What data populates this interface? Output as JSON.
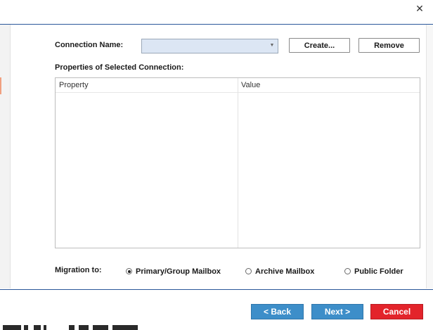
{
  "window": {
    "close_glyph": "✕"
  },
  "connection": {
    "label": "Connection Name:",
    "value": "",
    "create_button": "Create...",
    "remove_button": "Remove"
  },
  "properties": {
    "label": "Properties of Selected Connection:",
    "columns": [
      "Property",
      "Value"
    ],
    "rows": []
  },
  "migration": {
    "label": "Migration to:",
    "options": [
      {
        "label": "Primary/Group Mailbox",
        "selected": true
      },
      {
        "label": "Archive Mailbox",
        "selected": false
      },
      {
        "label": "Public Folder",
        "selected": false
      }
    ]
  },
  "footer": {
    "back_button": "< Back",
    "next_button": "Next >",
    "cancel_button": "Cancel"
  },
  "colors": {
    "accent_blue": "#3d8ec9",
    "cancel_red": "#e3242b",
    "combo_fill": "#dce6f4",
    "title_rule": "#2b579a"
  },
  "icons": {
    "close": "close-icon",
    "dropdown": "chevron-down-icon"
  }
}
